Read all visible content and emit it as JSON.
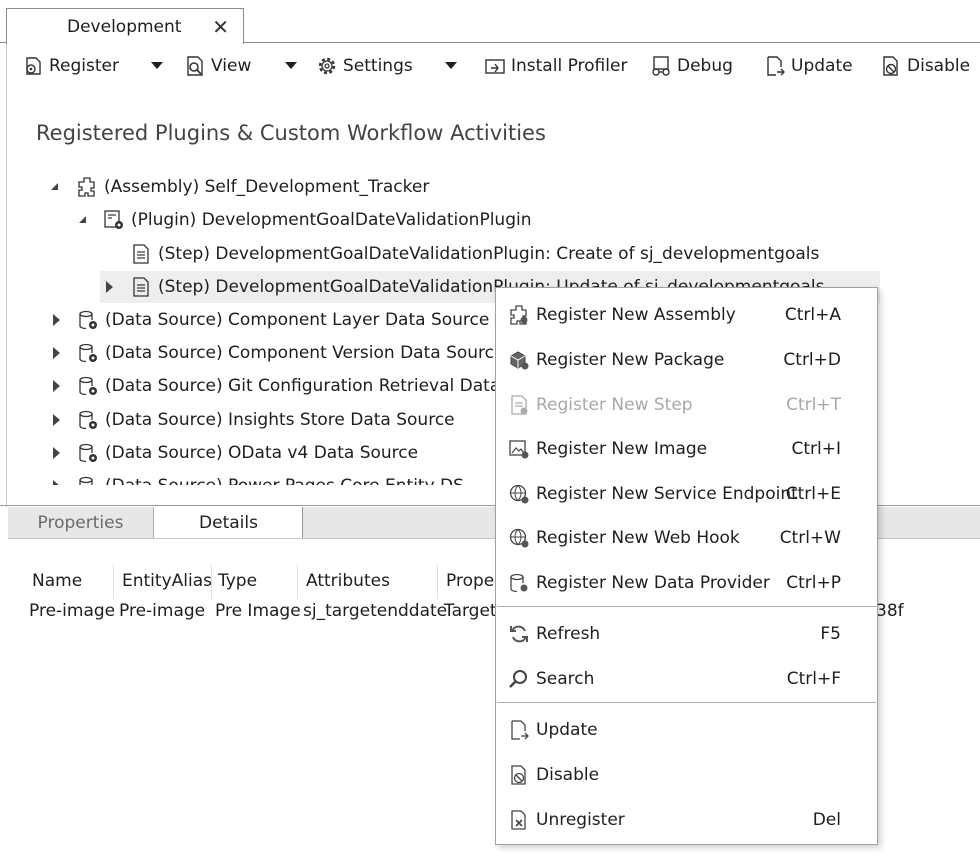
{
  "tab": {
    "title": "Development",
    "close_glyph": "✕"
  },
  "toolbar": {
    "register": "Register",
    "view": "View",
    "settings": "Settings",
    "install_profiler": "Install Profiler",
    "debug": "Debug",
    "update": "Update",
    "disable": "Disable"
  },
  "heading": "Registered Plugins & Custom Workflow Activities",
  "tree": {
    "rows": [
      {
        "label": "(Assembly) Self_Development_Tracker",
        "icon": "assembly-icon",
        "expander": "expanded"
      },
      {
        "label": "(Plugin) DevelopmentGoalDateValidationPlugin",
        "icon": "plugin-icon",
        "expander": "expanded"
      },
      {
        "label": "(Step) DevelopmentGoalDateValidationPlugin: Create of sj_developmentgoals",
        "icon": "step-icon",
        "expander": "none"
      },
      {
        "label": "(Step) DevelopmentGoalDateValidationPlugin: Update of sj_developmentgoals",
        "icon": "step-icon",
        "expander": "collapsed"
      },
      {
        "label": "(Data Source) Component Layer Data Source",
        "icon": "data-source-icon",
        "expander": "collapsed"
      },
      {
        "label": "(Data Source) Component Version Data Source",
        "icon": "data-source-icon",
        "expander": "collapsed"
      },
      {
        "label": "(Data Source) Git Configuration Retrieval Data Source",
        "icon": "data-source-icon",
        "expander": "collapsed"
      },
      {
        "label": "(Data Source) Insights Store Data Source",
        "icon": "data-source-icon",
        "expander": "collapsed"
      },
      {
        "label": "(Data Source) OData v4 Data Source",
        "icon": "data-source-icon",
        "expander": "collapsed"
      },
      {
        "label": "(Data Source) Power Pages Core Entity DS",
        "icon": "data-source-icon",
        "expander": "collapsed"
      }
    ]
  },
  "bottom_tabs": {
    "properties": "Properties",
    "details": "Details"
  },
  "grid": {
    "headers": [
      "Name",
      "EntityAlias",
      "Type",
      "Attributes",
      "Proper"
    ],
    "row": [
      "Pre-image",
      "Pre-image",
      "Pre Image",
      "sj_targetenddate",
      "Target"
    ],
    "trailing_value": "38f"
  },
  "context_menu": {
    "items": [
      {
        "label": "Register New Assembly",
        "shortcut": "Ctrl+A",
        "icon": "register-assembly-icon",
        "enabled": true
      },
      {
        "label": "Register New Package",
        "shortcut": "Ctrl+D",
        "icon": "register-package-icon",
        "enabled": true
      },
      {
        "label": "Register New Step",
        "shortcut": "Ctrl+T",
        "icon": "register-step-icon",
        "enabled": false
      },
      {
        "label": "Register New Image",
        "shortcut": "Ctrl+I",
        "icon": "register-image-icon",
        "enabled": true
      },
      {
        "label": "Register New Service Endpoint",
        "shortcut": "Ctrl+E",
        "icon": "register-service-endpoint-icon",
        "enabled": true
      },
      {
        "label": "Register New Web Hook",
        "shortcut": "Ctrl+W",
        "icon": "register-web-hook-icon",
        "enabled": true
      },
      {
        "label": "Register New Data Provider",
        "shortcut": "Ctrl+P",
        "icon": "register-data-provider-icon",
        "enabled": true
      },
      {
        "label": "Refresh",
        "shortcut": "F5",
        "icon": "refresh-icon",
        "enabled": true
      },
      {
        "label": "Search",
        "shortcut": "Ctrl+F",
        "icon": "search-icon",
        "enabled": true
      },
      {
        "label": "Update",
        "shortcut": "",
        "icon": "update-icon",
        "enabled": true
      },
      {
        "label": "Disable",
        "shortcut": "",
        "icon": "disable-icon",
        "enabled": true
      },
      {
        "label": "Unregister",
        "shortcut": "Del",
        "icon": "unregister-icon",
        "enabled": true
      }
    ]
  }
}
